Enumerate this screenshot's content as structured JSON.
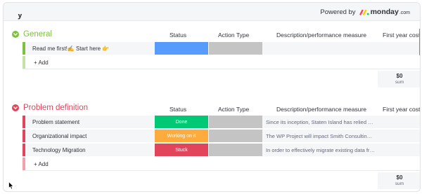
{
  "header": {
    "title_fragment": "y                         ",
    "powered_by": "Powered by",
    "brand": "monday",
    "brand_suffix": ".com"
  },
  "columns": {
    "status": "Status",
    "action_type": "Action Type",
    "description": "Description/performance measure",
    "first_year_costs": "First year costs"
  },
  "groups": [
    {
      "title": "General",
      "color": "#7ec13e",
      "rows": [
        {
          "name": "Read me first!✍ Start here 👉",
          "status": "",
          "status_color": "#579bfc",
          "description": ""
        }
      ],
      "add_label": "+ Add",
      "sum_value": "$0",
      "sum_label": "sum"
    },
    {
      "title": "Problem definition",
      "color": "#e2445c",
      "rows": [
        {
          "name": "Problem statement",
          "status": "Done",
          "status_color": "#00c875",
          "description": "Since its inception, Staten Island has relied up..."
        },
        {
          "name": "Organizational impact",
          "status": "Working on it",
          "status_color": "#fdab3d",
          "description": "The WP Project will impact Smith Consulting i..."
        },
        {
          "name": "Technology Migration",
          "status": "Stuck",
          "status_color": "#e2445c",
          "description": "In order to effectively migrate existing data fro..."
        }
      ],
      "add_label": "+ Add",
      "sum_value": "$0",
      "sum_label": "sum"
    }
  ],
  "icons": {
    "chevron": "chevron-down-icon",
    "logo": "monday-logo-icon",
    "cursor": "mouse-cursor-icon"
  },
  "colors": {
    "action_cell": "#c4c4c4",
    "row_bg": "#f5f6f8",
    "brand_red": "#ff3d57",
    "brand_yellow": "#ffcb00",
    "brand_green": "#00d647"
  }
}
